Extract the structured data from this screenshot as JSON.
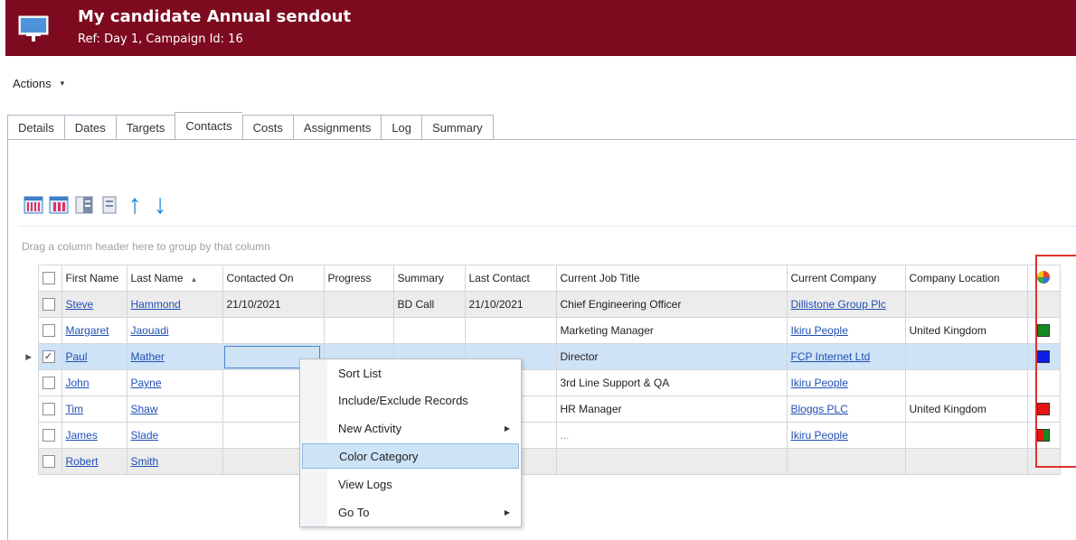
{
  "header": {
    "title": "My candidate Annual sendout",
    "subtitle": "Ref: Day 1, Campaign Id: 16"
  },
  "actions": {
    "label": "Actions",
    "caret": "▾"
  },
  "tabs": [
    {
      "label": "Details"
    },
    {
      "label": "Dates"
    },
    {
      "label": "Targets"
    },
    {
      "label": "Contacts"
    },
    {
      "label": "Costs"
    },
    {
      "label": "Assignments"
    },
    {
      "label": "Log"
    },
    {
      "label": "Summary"
    }
  ],
  "active_tab": "Contacts",
  "toolbar": {
    "arrow_up": "↑",
    "arrow_down": "↓"
  },
  "grid": {
    "group_hint": "Drag a column header here to group by that column",
    "columns": [
      "First Name",
      "Last Name",
      "Contacted On",
      "Progress",
      "Summary",
      "Last Contact",
      "Current Job Title",
      "Current Company",
      "Company Location"
    ],
    "rows": [
      {
        "first": "Steve",
        "last": "Hammond",
        "contacted": "21/10/2021",
        "progress": "",
        "summary": "BD Call",
        "last_contact": "21/10/2021",
        "job": "Chief Engineering Officer",
        "company": "Dillistone Group Plc",
        "location": "",
        "checked": "",
        "color": ""
      },
      {
        "first": "Margaret",
        "last": "Jaouadi",
        "contacted": "",
        "progress": "",
        "summary": "",
        "last_contact": "",
        "job": "Marketing Manager",
        "company": "Ikiru People",
        "location": "United Kingdom",
        "checked": "",
        "color": "#138a1e"
      },
      {
        "first": "Paul",
        "last": "Mather",
        "contacted": "",
        "progress": "",
        "summary": "",
        "last_contact": "",
        "job": "Director",
        "company": "FCP Internet Ltd",
        "location": "",
        "checked": "✓",
        "color": "#0a1ee6"
      },
      {
        "first": "John",
        "last": "Payne",
        "contacted": "",
        "progress": "",
        "summary": "",
        "last_contact": "",
        "job": "3rd Line Support & QA",
        "company": "Ikiru People",
        "location": "",
        "checked": "",
        "color": ""
      },
      {
        "first": "Tim",
        "last": "Shaw",
        "contacted": "",
        "progress": "",
        "summary": "",
        "last_contact": "",
        "job": "HR Manager",
        "company": "Bloggs PLC",
        "location": "United Kingdom",
        "checked": "",
        "color": "#e81414"
      },
      {
        "first": "James",
        "last": "Slade",
        "contacted": "",
        "progress": "",
        "summary": "",
        "last_contact": "",
        "job": "...",
        "company": "Ikiru People",
        "location": "",
        "checked": "",
        "color": "split"
      },
      {
        "first": "Robert",
        "last": "Smith",
        "contacted": "",
        "progress": "",
        "summary": "",
        "last_contact": "",
        "job": "",
        "company": "",
        "location": "",
        "checked": "",
        "color": ""
      }
    ],
    "selected_indicator": "▶"
  },
  "context_menu": {
    "items": [
      {
        "label": "Sort List",
        "submenu": ""
      },
      {
        "label": "Include/Exclude Records",
        "submenu": ""
      },
      {
        "label": "New Activity",
        "submenu": "▶"
      },
      {
        "label": "Color Category",
        "submenu": ""
      },
      {
        "label": "View Logs",
        "submenu": ""
      },
      {
        "label": "Go To",
        "submenu": "▶"
      }
    ],
    "highlighted": "Color Category"
  },
  "colors": {
    "header_bg": "#7d0a1e",
    "link": "#1f4fb5",
    "selection": "#cfe3f6",
    "accent_arrow": "#1a87d8",
    "highlight_frame": "#e03030"
  }
}
